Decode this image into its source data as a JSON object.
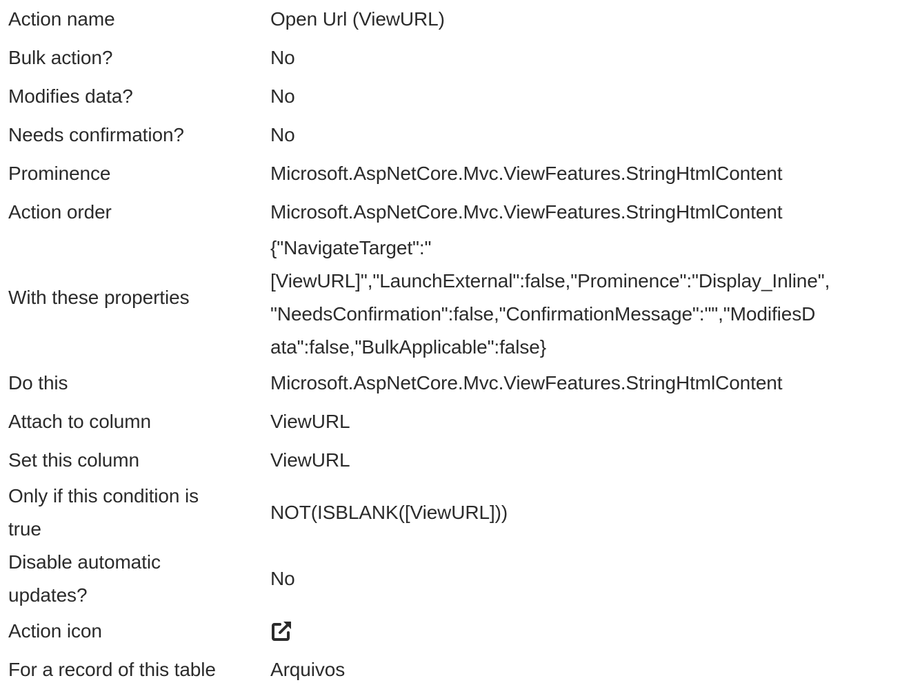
{
  "rows": [
    {
      "key": "Action name",
      "value": "Open Url (ViewURL)"
    },
    {
      "key": "Bulk action?",
      "value": "No"
    },
    {
      "key": "Modifies data?",
      "value": "No"
    },
    {
      "key": "Needs confirmation?",
      "value": "No"
    },
    {
      "key": "Prominence",
      "value": "Microsoft.AspNetCore.Mvc.ViewFeatures.StringHtmlContent"
    },
    {
      "key": "Action order",
      "value": "Microsoft.AspNetCore.Mvc.ViewFeatures.StringHtmlContent"
    },
    {
      "key": "With these properties",
      "value_lines": [
        "{\"NavigateTarget\":\"",
        "[ViewURL]\",\"LaunchExternal\":false,\"Prominence\":\"Display_Inline\",",
        "\"NeedsConfirmation\":false,\"ConfirmationMessage\":\"\",\"ModifiesD",
        "ata\":false,\"BulkApplicable\":false}"
      ]
    },
    {
      "key": "Do this",
      "value": "Microsoft.AspNetCore.Mvc.ViewFeatures.StringHtmlContent"
    },
    {
      "key": "Attach to column",
      "value": "ViewURL"
    },
    {
      "key": "Set this column",
      "value": "ViewURL"
    },
    {
      "key_lines": [
        "Only if this condition is",
        "true"
      ],
      "value": "NOT(ISBLANK([ViewURL]))"
    },
    {
      "key_lines": [
        "Disable automatic",
        "updates?"
      ],
      "value": "No"
    },
    {
      "key": "Action icon",
      "icon": "external-link-icon"
    },
    {
      "key": "For a record of this table",
      "value": "Arquivos"
    }
  ]
}
